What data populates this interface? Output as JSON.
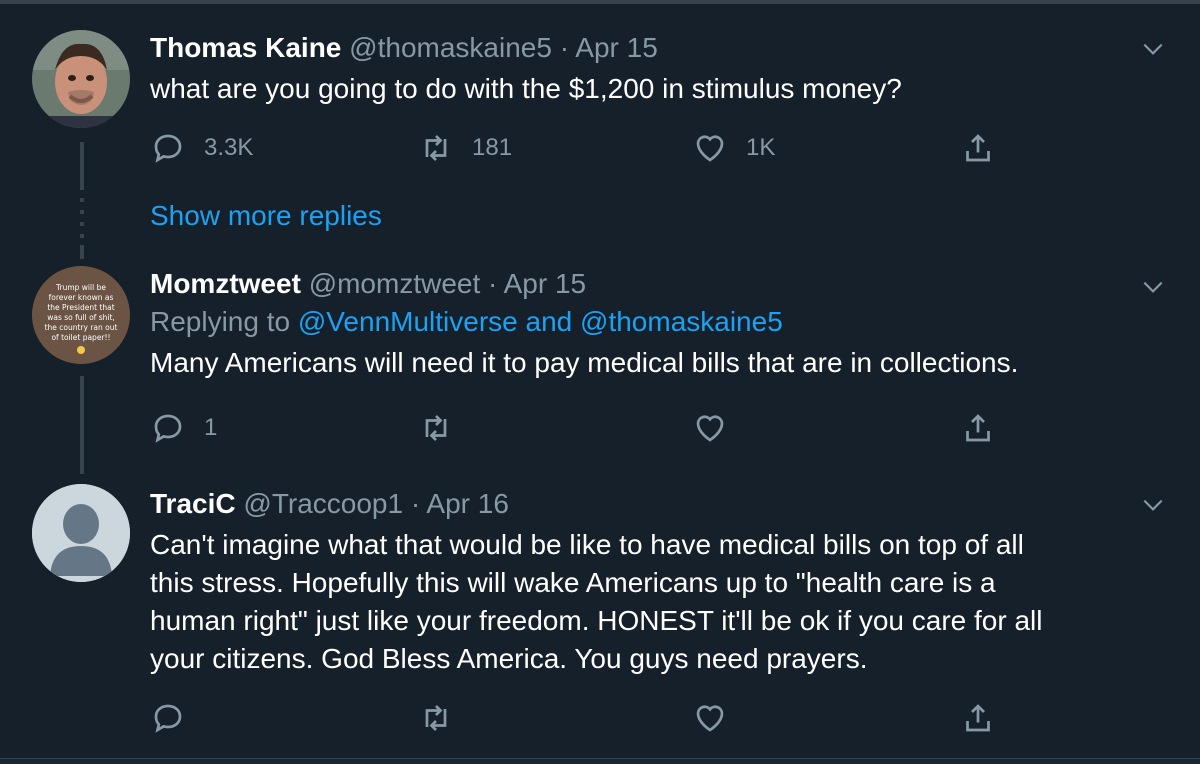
{
  "show_more_label": "Show more replies",
  "tweets": [
    {
      "name": "Thomas Kaine",
      "handle": "@thomaskaine5",
      "sep": "·",
      "date": "Apr 15",
      "text": "what are you going to do with the $1,200 in stimulus money?",
      "replies": "3.3K",
      "retweets": "181",
      "likes": "1K"
    },
    {
      "name": "Momztweet",
      "handle": "@momztweet",
      "sep": "·",
      "date": "Apr 15",
      "replying_prefix": "Replying to",
      "replying_user1": "@VennMultiverse",
      "replying_and": "and",
      "replying_user2": "@thomaskaine5",
      "text": "Many Americans will need it to pay medical bills that are in collections.",
      "replies": "1",
      "retweets": "",
      "likes": "",
      "avatar_text": "Trump will be forever known as the President that was so full of shit, the country ran out of toilet paper!!"
    },
    {
      "name": "TraciC",
      "handle": "@Traccoop1",
      "sep": "·",
      "date": "Apr 16",
      "text_lines": [
        "Can't imagine what that would be like to have medical bills on top of all",
        "this stress. Hopefully this will wake Americans up to \"health care is a",
        "human right\" just like your freedom. HONEST it'll be ok if you care for all",
        "your citizens. God Bless America. You guys need prayers."
      ],
      "replies": "",
      "retweets": "",
      "likes": ""
    }
  ],
  "colors": {
    "background": "#15202b",
    "secondary_text": "#8899a6",
    "accent": "#1da1f2",
    "border": "#38444d"
  }
}
